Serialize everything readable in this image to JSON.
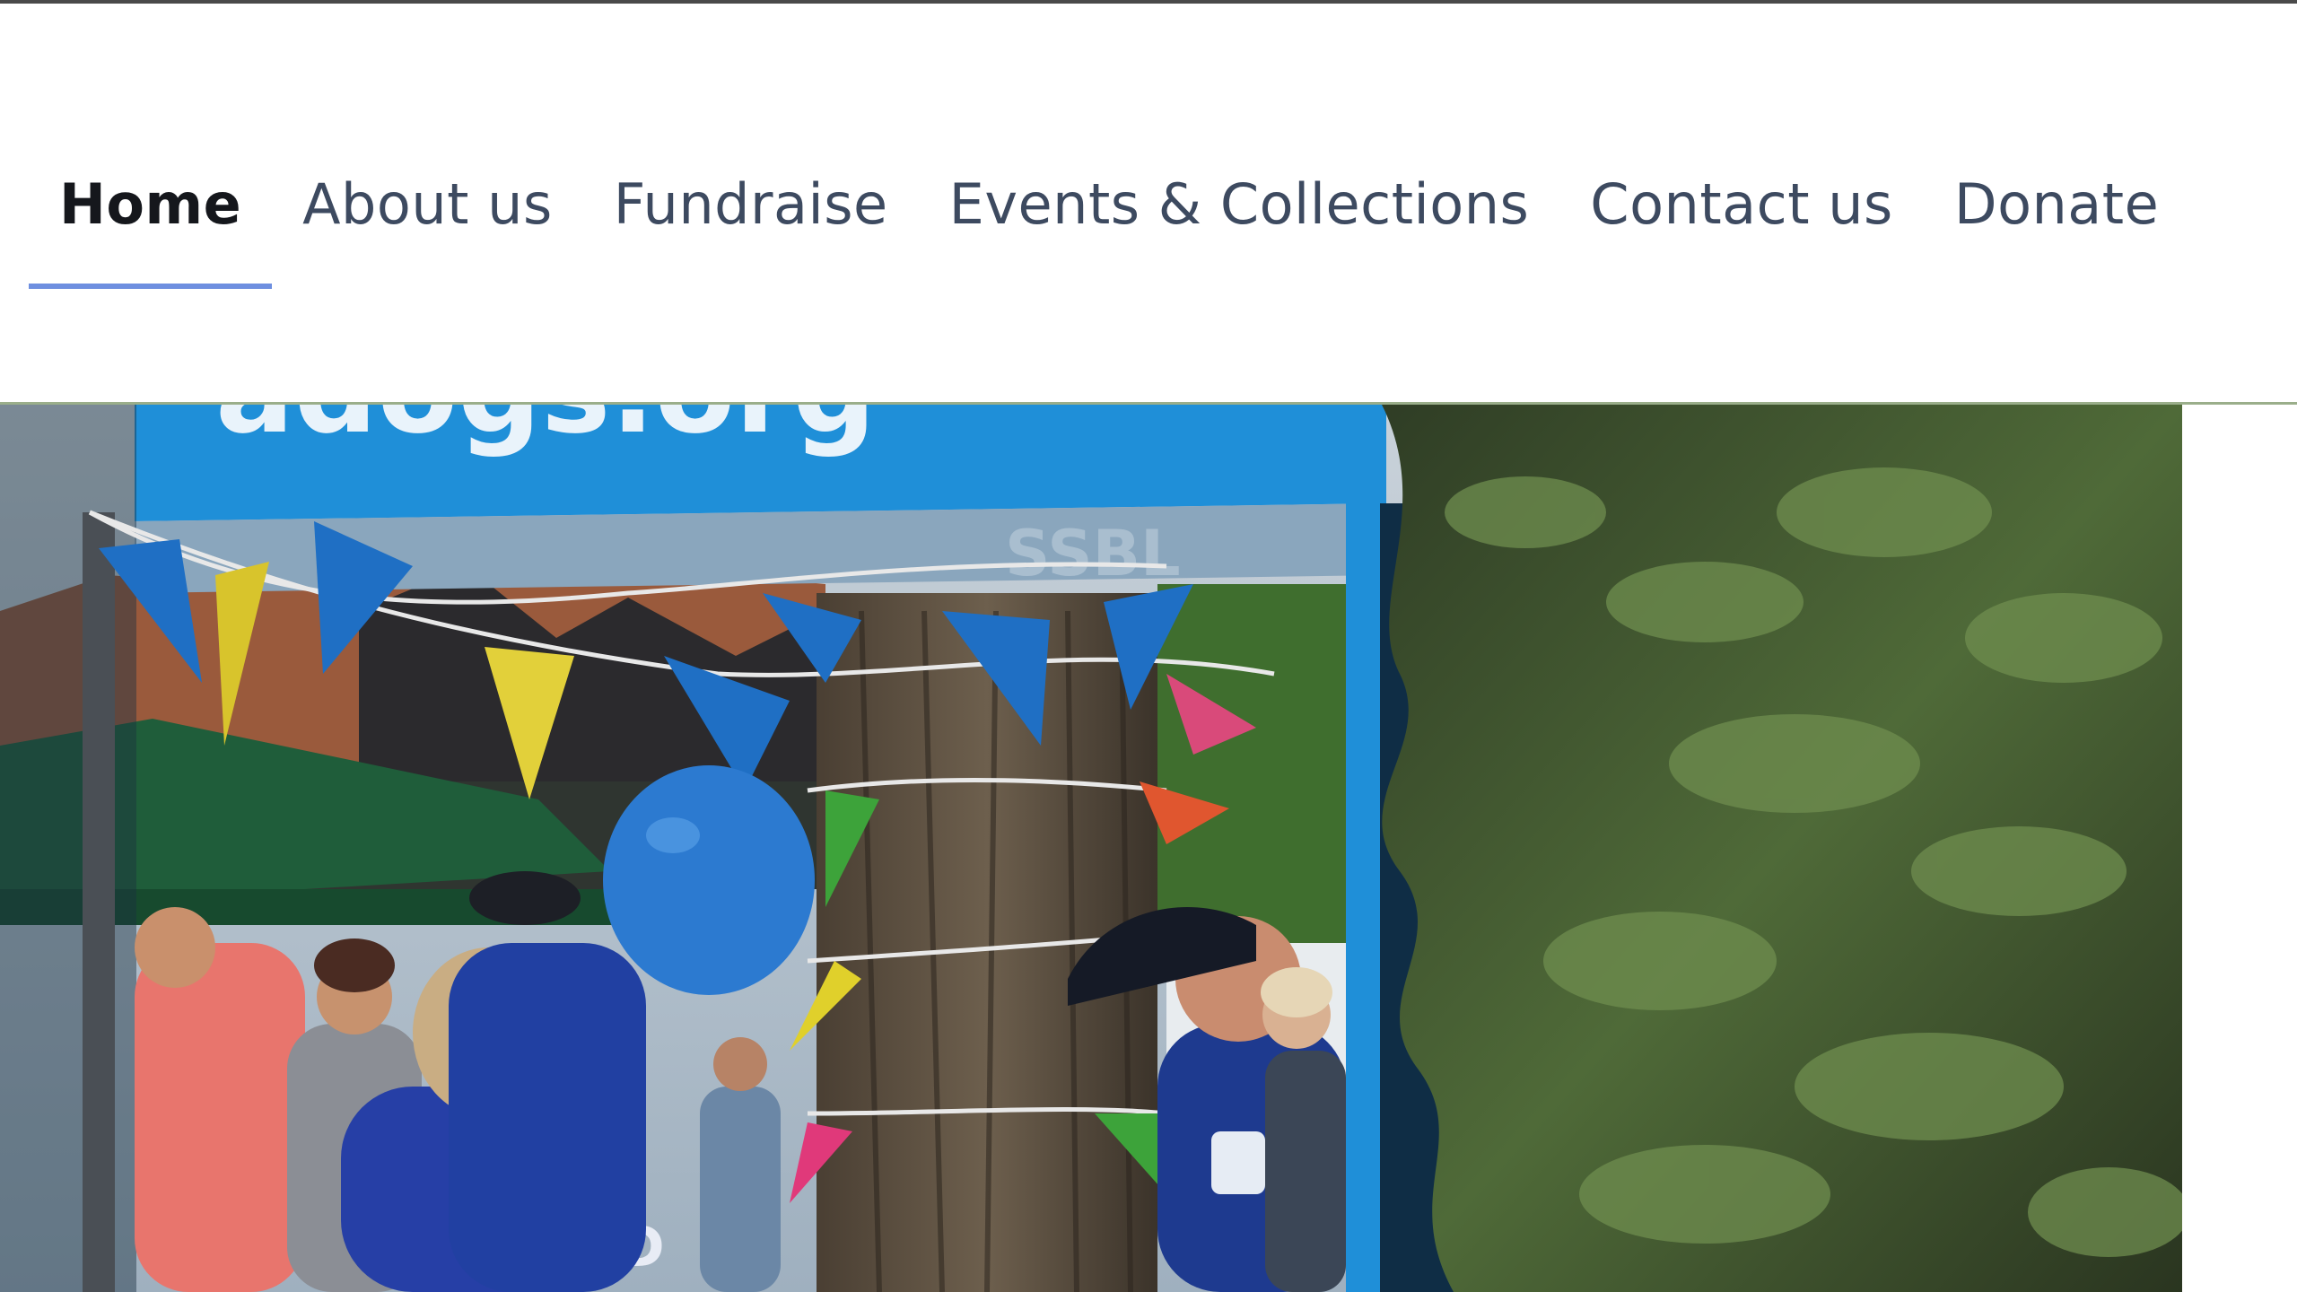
{
  "nav": {
    "items": [
      {
        "label": "Home",
        "active": true
      },
      {
        "label": "About us",
        "active": false
      },
      {
        "label": "Fundraise",
        "active": false
      },
      {
        "label": "Events & Collections",
        "active": false
      },
      {
        "label": "Contact us",
        "active": false
      },
      {
        "label": "Donate",
        "active": false
      }
    ]
  },
  "colors": {
    "nav_text": "#3d4a60",
    "nav_active_text": "#15171c",
    "nav_underline": "#6e8fe0",
    "gazebo_blue": "#1f8fd8"
  },
  "hero": {
    "image": "photo of charity event stall with blue gazebo, bunting, balloon, tree and volunteers"
  }
}
